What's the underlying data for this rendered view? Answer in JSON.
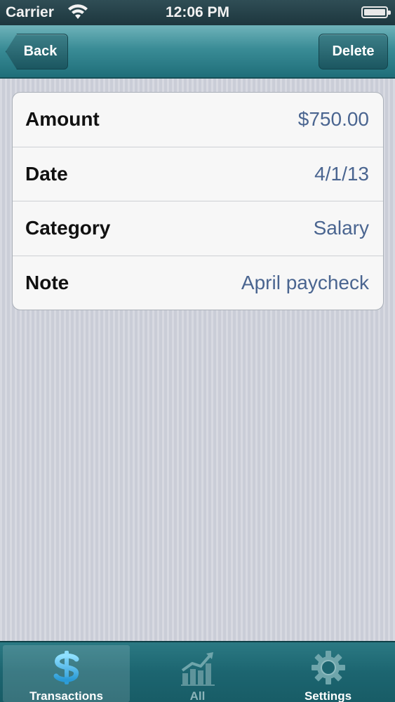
{
  "status_bar": {
    "carrier": "Carrier",
    "time": "12:06 PM",
    "battery_level": 1.0
  },
  "nav": {
    "back_label": "Back",
    "delete_label": "Delete"
  },
  "details": [
    {
      "label": "Amount",
      "value": "$750.00"
    },
    {
      "label": "Date",
      "value": "4/1/13"
    },
    {
      "label": "Category",
      "value": "Salary"
    },
    {
      "label": "Note",
      "value": "April paycheck"
    }
  ],
  "tabs": [
    {
      "label": "Transactions",
      "icon": "dollar-icon",
      "active": true
    },
    {
      "label": "All",
      "icon": "chart-icon",
      "active": false
    },
    {
      "label": "Settings",
      "icon": "gear-icon",
      "active": false
    }
  ],
  "colors": {
    "nav_teal": "#3a8c96",
    "value_blue": "#4a6590",
    "tab_bar": "#1c6570",
    "active_icon": "#5bc6f0"
  }
}
